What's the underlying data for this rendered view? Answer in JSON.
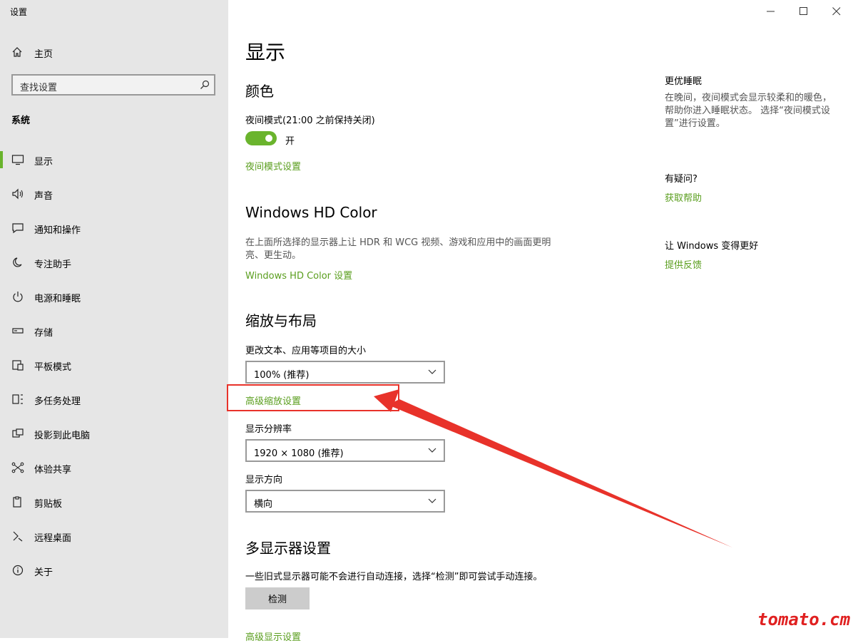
{
  "app": {
    "title": "设置"
  },
  "sidebar": {
    "home_label": "主页",
    "search_placeholder": "查找设置",
    "section_label": "系统",
    "items": [
      {
        "label": "显示",
        "icon": "monitor-icon",
        "active": true
      },
      {
        "label": "声音",
        "icon": "speaker-icon"
      },
      {
        "label": "通知和操作",
        "icon": "message-icon"
      },
      {
        "label": "专注助手",
        "icon": "moon-icon"
      },
      {
        "label": "电源和睡眠",
        "icon": "power-icon"
      },
      {
        "label": "存储",
        "icon": "storage-icon"
      },
      {
        "label": "平板模式",
        "icon": "tablet-icon"
      },
      {
        "label": "多任务处理",
        "icon": "multitask-icon"
      },
      {
        "label": "投影到此电脑",
        "icon": "project-icon"
      },
      {
        "label": "体验共享",
        "icon": "share-icon"
      },
      {
        "label": "剪贴板",
        "icon": "clipboard-icon"
      },
      {
        "label": "远程桌面",
        "icon": "remote-icon"
      },
      {
        "label": "关于",
        "icon": "info-icon"
      }
    ]
  },
  "main": {
    "title": "显示",
    "color": {
      "heading": "颜色",
      "night_mode_label": "夜间模式(21:00 之前保持关闭)",
      "toggle_state": "开",
      "night_mode_link": "夜间模式设置"
    },
    "hdr": {
      "heading": "Windows HD Color",
      "description": "在上面所选择的显示器上让 HDR 和 WCG 视频、游戏和应用中的画面更明亮、更生动。",
      "link": "Windows HD Color 设置"
    },
    "scale": {
      "heading": "缩放与布局",
      "size_label": "更改文本、应用等项目的大小",
      "size_value": "100% (推荐)",
      "advanced_link": "高级缩放设置",
      "resolution_label": "显示分辨率",
      "resolution_value": "1920 × 1080 (推荐)",
      "orientation_label": "显示方向",
      "orientation_value": "横向"
    },
    "multi": {
      "heading": "多显示器设置",
      "description": "一些旧式显示器可能不会进行自动连接，选择“检测”即可尝试手动连接。",
      "detect_button": "检测",
      "advanced_link": "高级显示设置"
    }
  },
  "right": {
    "sleep_heading": "更优睡眠",
    "sleep_desc": "在晚间，夜间模式会显示较柔和的暖色，帮助你进入睡眠状态。 选择“夜间模式设置”进行设置。",
    "question_heading": "有疑问?",
    "help_link": "获取帮助",
    "improve_heading": "让 Windows 变得更好",
    "feedback_link": "提供反馈"
  },
  "annotation": {
    "color": "#e8322a"
  },
  "watermark": "tomato.cm",
  "colors": {
    "accent": "#6ab42d",
    "link": "#5a9e1e",
    "sidebar_bg": "#e6e6e6"
  }
}
